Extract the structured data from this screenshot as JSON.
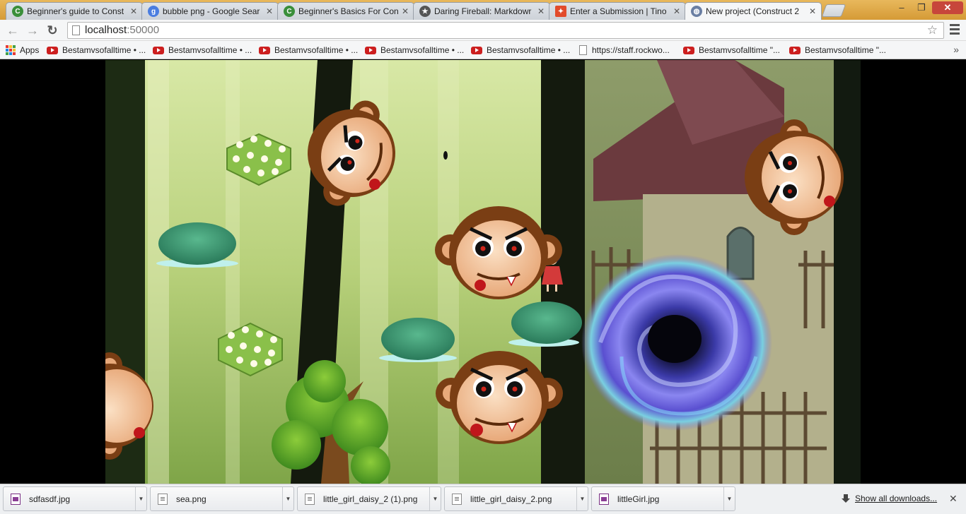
{
  "tabs": [
    {
      "title": "Beginner's guide to Const",
      "icon": "construct-icon",
      "color": "#3a8f3a"
    },
    {
      "title": "bubble png - Google Sear",
      "icon": "google-icon",
      "color": "#4a7de0"
    },
    {
      "title": "Beginner's Basics For Con",
      "icon": "construct-icon",
      "color": "#3a8f3a"
    },
    {
      "title": "Daring Fireball: Markdowr",
      "icon": "star-icon",
      "color": "#555555"
    },
    {
      "title": "Enter a Submission | Tino",
      "icon": "puzzle-icon",
      "color": "#e24b2b"
    },
    {
      "title": "New project (Construct 2",
      "icon": "globe-icon",
      "color": "#6b7fa3",
      "active": true
    }
  ],
  "tab_close_glyph": "✕",
  "window_controls": {
    "minimize": "–",
    "maximize": "❐",
    "close": "✕"
  },
  "toolbar": {
    "back_glyph": "←",
    "forward_glyph": "→",
    "reload_glyph": "↻",
    "url_host": "localhost",
    "url_port": ":50000",
    "star_glyph": "☆"
  },
  "bookmarks": [
    {
      "label": "Apps",
      "icon": "apps-icon"
    },
    {
      "label": "Bestamvsofalltime • ...",
      "icon": "youtube-icon"
    },
    {
      "label": "Bestamvsofalltime • ...",
      "icon": "youtube-icon"
    },
    {
      "label": "Bestamvsofalltime • ...",
      "icon": "youtube-icon"
    },
    {
      "label": "Bestamvsofalltime • ...",
      "icon": "youtube-icon"
    },
    {
      "label": "Bestamvsofalltime • ...",
      "icon": "youtube-icon"
    },
    {
      "label": "https://staff.rockwo...",
      "icon": "page-icon"
    },
    {
      "label": "Bestamvsofalltime \"...",
      "icon": "youtube-icon"
    },
    {
      "label": "Bestamvsofalltime \"...",
      "icon": "youtube-icon"
    }
  ],
  "bookmarks_more": "»",
  "downloads": [
    {
      "name": "sdfasdf.jpg",
      "type": "jpg"
    },
    {
      "name": "sea.png",
      "type": "png"
    },
    {
      "name": "little_girl_daisy_2 (1).png",
      "type": "png"
    },
    {
      "name": "little_girl_daisy_2.png",
      "type": "png"
    },
    {
      "name": "littleGirl.jpg",
      "type": "jpg"
    }
  ],
  "download_arrow": "▼",
  "show_all_downloads": "Show all downloads...",
  "shelf_close": "✕",
  "colors": {
    "frame": "#d9a441",
    "game_grass": "#b7d07a",
    "monkey_face": "#f0b98a",
    "monkey_fur": "#7a3e14",
    "portal": "#5a4fd0"
  }
}
